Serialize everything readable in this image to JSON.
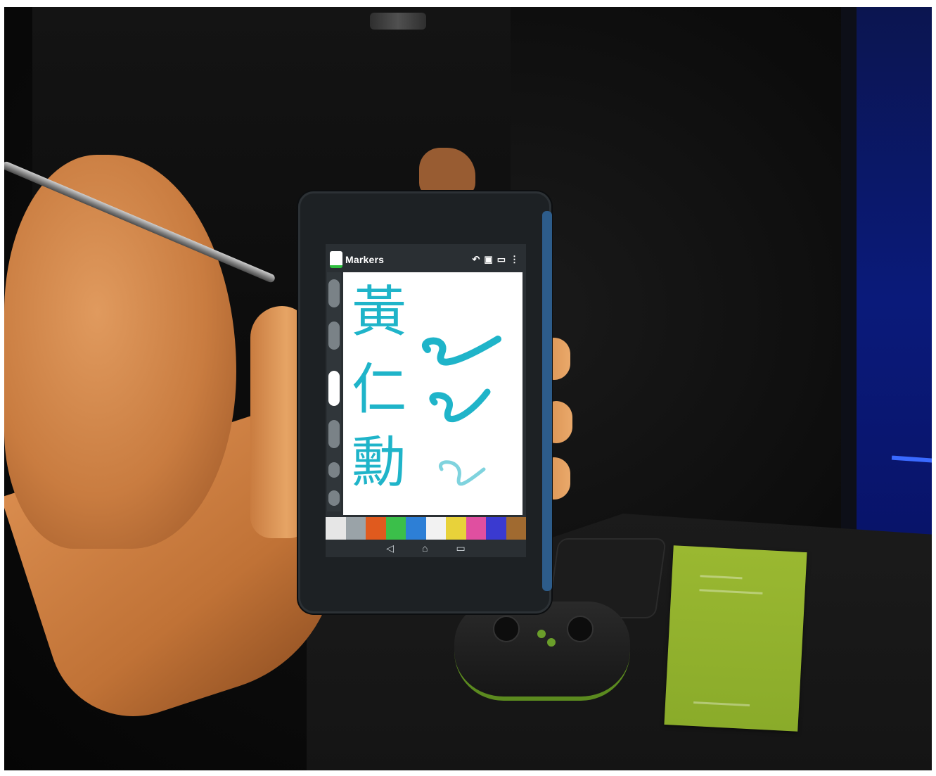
{
  "scene": {
    "description_free": true
  },
  "tablet_app": {
    "title": "Markers",
    "action_icons": [
      "undo-icon",
      "layers-icon",
      "gallery-icon",
      "overflow-menu-icon"
    ],
    "handwritten_text": [
      "黃",
      "仁",
      "勳"
    ],
    "ink_color": "#1fb4c9",
    "palette_colors": [
      "#e6e6e6",
      "#9aa3a8",
      "#e05a1e",
      "#3bbf4a",
      "#2d7fd6",
      "#f2f2f2",
      "#e8d23a",
      "#e04fa0",
      "#3a3ad0",
      "#a06a30"
    ],
    "nav_icons": [
      "back-icon",
      "home-icon",
      "recent-apps-icon"
    ]
  },
  "colors": {
    "background": "#0c0c0c",
    "card_green": "#9ab831",
    "tablet_accent": "#2d5c8a"
  }
}
